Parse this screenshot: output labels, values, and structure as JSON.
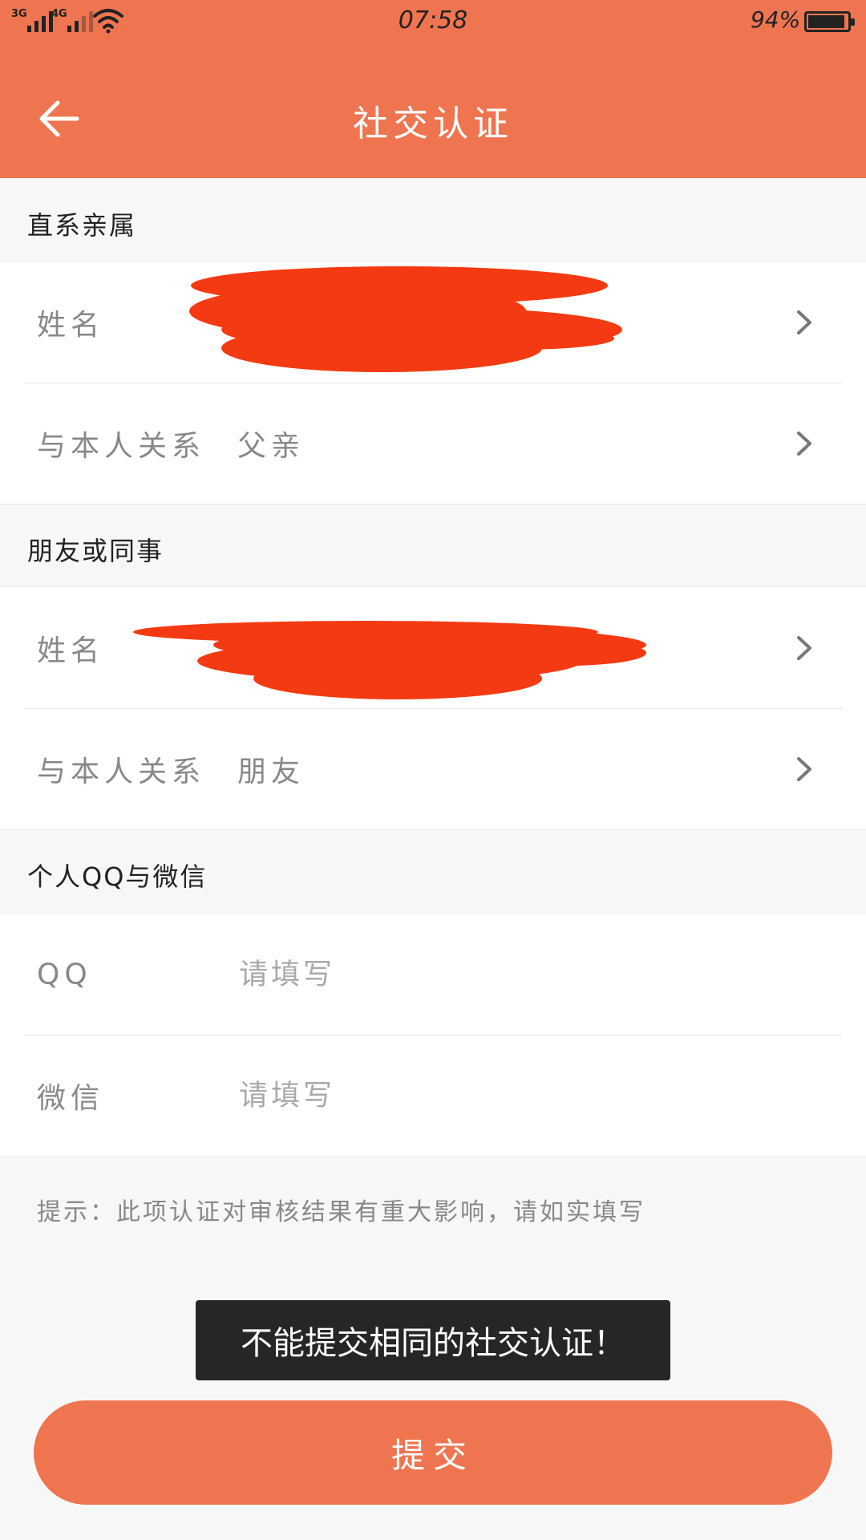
{
  "status": {
    "network_1": "3G",
    "network_2": "4G",
    "time": "07:58",
    "battery_pct": "94%",
    "battery_level": 0.94
  },
  "header": {
    "title": "社交认证",
    "back_icon": "arrow-left-icon"
  },
  "section1": {
    "title": "直系亲属",
    "name_label": "姓名",
    "relation_label": "与本人关系",
    "relation_value": "父亲"
  },
  "section2": {
    "title": "朋友或同事",
    "name_label": "姓名",
    "relation_label": "与本人关系",
    "relation_value": "朋友"
  },
  "section3": {
    "title": "个人QQ与微信",
    "qq_label": "QQ",
    "qq_placeholder": "请填写",
    "wechat_label": "微信",
    "wechat_placeholder": "请填写"
  },
  "hint": "提示：此项认证对审核结果有重大影响，请如实填写",
  "toast": "不能提交相同的社交认证！",
  "submit_label": "提交",
  "colors": {
    "accent": "#ef7550",
    "redaction": "#f43a12",
    "toast_bg": "#262626"
  }
}
